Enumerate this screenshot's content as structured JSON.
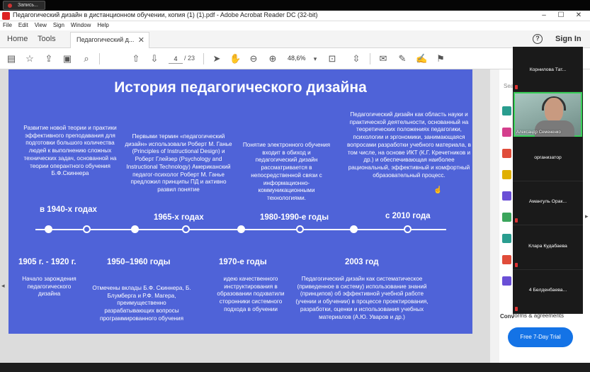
{
  "recording": {
    "label": "Запись..."
  },
  "window": {
    "title": "Педагогический дизайн в дистанционном обучении, копия (1) (1).pdf - Adobe Acrobat Reader DC (32-bit)",
    "minimize": "–",
    "maximize": "☐",
    "close": "✕"
  },
  "menu": [
    "File",
    "Edit",
    "View",
    "Sign",
    "Window",
    "Help"
  ],
  "tabs": {
    "home": "Home",
    "tools": "Tools",
    "doc": "Педагогический д...",
    "close": "✕"
  },
  "header_right": {
    "help": "?",
    "signin": "Sign In"
  },
  "toolbar": {
    "page_current": "4",
    "page_total": "/ 23",
    "zoom": "48,6%",
    "icons": [
      "save-icon",
      "bookmark-star-icon",
      "upload-icon",
      "print-icon",
      "search-zoom-icon",
      "prev-page-icon",
      "next-page-icon",
      "select-cursor-icon",
      "hand-icon",
      "zoom-out-icon",
      "zoom-in-icon",
      "fit-page-icon",
      "scroll-mode-icon",
      "comment-icon",
      "highlight-icon",
      "sign-icon",
      "fill-sign-icon"
    ]
  },
  "slide": {
    "title": "История педагогического дизайна",
    "top_texts": {
      "t1": "Развитие новой теории и практики эффективного преподавания для подготовки большого количества людей к выполнению сложных технических задач, основанной на теории оперантного обучения Б.Ф.Скиннера",
      "t2": "Первыми термин «педагогический дизайн» использовали Роберт М. Ганье (Principles of Instructional Design) и Роберт Глейзер (Psychology and Instructional Technology) Американский педагог-психолог Роберт М. Ганье предложил принципы ПД и активно развил понятие",
      "t3": "Понятие электронного обучения входит в обиход и педагогический дизайн  рассматривается в непосредственной связи с информационно-коммуникационными технологиями.",
      "t4": "Педагогический дизайн как область науки и практической деятельности, основанный на теоретических положениях педагогики, психологии и эргономики, занимающаяся вопросами разработки учебного материала, в том числе, на основе ИКТ (К.Г. Кречетников и др.) и обеспечивающая наиболее рациональный, эффективный и комфортный образовательный процесс."
    },
    "top_headings": {
      "h1": "в 1940-х годах",
      "h2": "1965-х годах",
      "h3": "1980-1990-е годы",
      "h4": "с 2010 года"
    },
    "bottom_headings": {
      "h1": "1905 г. - 1920 г.",
      "h2": "1950–1960 годы",
      "h3": "1970-е годы",
      "h4": "2003 год"
    },
    "bottom_texts": {
      "b1": "Начало зарождения педагогического дизайна",
      "b2": "Отмечены вклады Б.Ф. Скиннера, Б. Блумберга и Р.Ф. Магера, преимущественно разрабатывающих вопросы программированного обучения",
      "b3": "идею качественного инструктирования в образовании подхватили сторонники системного подхода в обучении",
      "b4": "Педагогический дизайн как систематическое (приведенное в систему) использование знаний (принципов) об эффективной учебной работе (учении и обучении) в процессе проектирования, разработки, оценки и использования учебных материалов (А.Ю. Уваров и др.)"
    }
  },
  "right_panel": {
    "search": "Sea",
    "more": "Conv",
    "forms": "forms & agreements",
    "trial": "Free 7-Day Trial"
  },
  "participants": [
    {
      "name": "Корнилова  Тат..."
    },
    {
      "name": "Александр Семененко"
    },
    {
      "name": "организатор"
    },
    {
      "name": "Амангуль  Орак..."
    },
    {
      "name": "Клара Кудабаева"
    },
    {
      "name": "4  Белденбаева..."
    }
  ],
  "colors": {
    "slide_bg": "#4f63d8",
    "trial_btn": "#1473e6",
    "active_speaker": "#39d15a",
    "muted": "#d33333"
  }
}
